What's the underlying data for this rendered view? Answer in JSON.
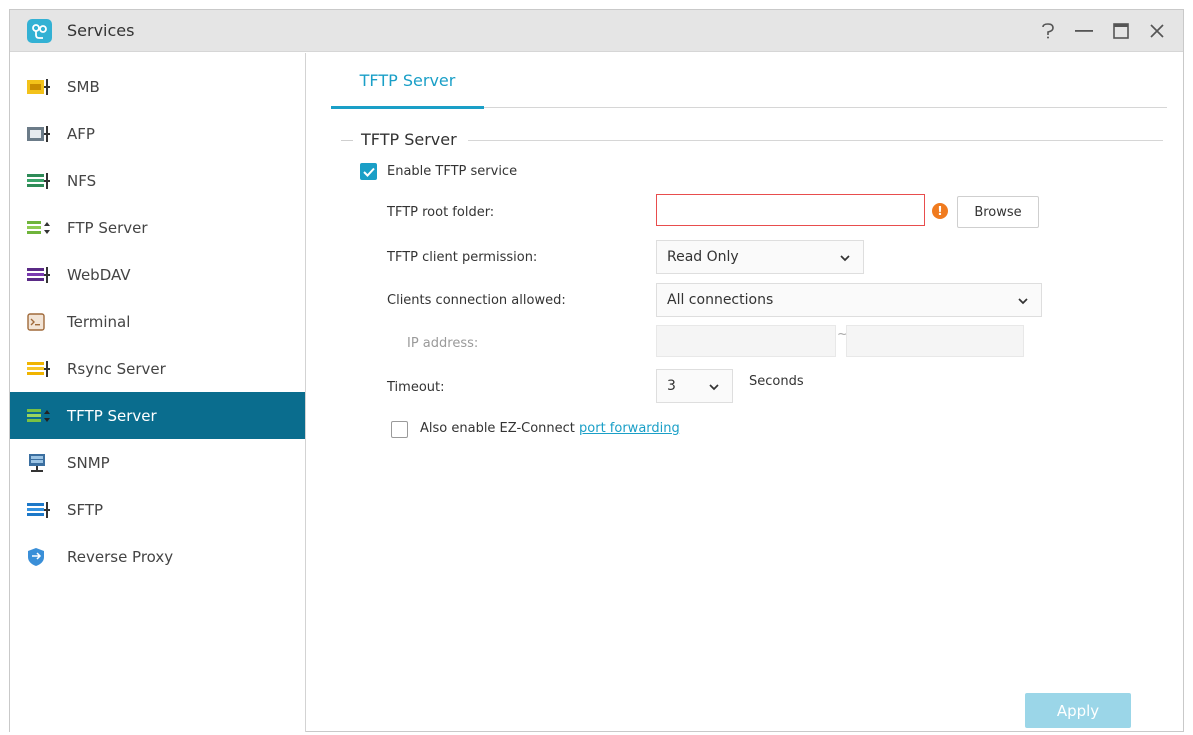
{
  "window": {
    "title": "Services",
    "controls": [
      "help-icon",
      "minimize-icon",
      "maximize-icon",
      "close-icon"
    ]
  },
  "sidebar": {
    "items": [
      {
        "label": "SMB",
        "icon": "smb-icon",
        "active": false
      },
      {
        "label": "AFP",
        "icon": "afp-icon",
        "active": false
      },
      {
        "label": "NFS",
        "icon": "nfs-icon",
        "active": false
      },
      {
        "label": "FTP Server",
        "icon": "ftp-server-icon",
        "active": false
      },
      {
        "label": "WebDAV",
        "icon": "webdav-icon",
        "active": false
      },
      {
        "label": "Terminal",
        "icon": "terminal-icon",
        "active": false
      },
      {
        "label": "Rsync Server",
        "icon": "rsync-server-icon",
        "active": false
      },
      {
        "label": "TFTP Server",
        "icon": "tftp-server-icon",
        "active": true
      },
      {
        "label": "SNMP",
        "icon": "snmp-icon",
        "active": false
      },
      {
        "label": "SFTP",
        "icon": "sftp-icon",
        "active": false
      },
      {
        "label": "Reverse Proxy",
        "icon": "reverse-proxy-icon",
        "active": false
      }
    ]
  },
  "tabs": [
    {
      "label": "TFTP Server",
      "active": true
    }
  ],
  "form": {
    "section_title": "TFTP Server",
    "enable_label": "Enable TFTP service",
    "enable_checked": true,
    "root_folder_label": "TFTP root folder:",
    "root_folder_value": "",
    "browse_label": "Browse",
    "permission_label": "TFTP client permission:",
    "permission_value": "Read Only",
    "connection_label": "Clients connection allowed:",
    "connection_value": "All connections",
    "ip_label": "IP address:",
    "ip_separator": "~",
    "timeout_label": "Timeout:",
    "timeout_value": "3",
    "timeout_unit": "Seconds",
    "ez_connect_prefix": "Also enable EZ-Connect",
    "ez_connect_link": "port forwarding",
    "ez_connect_checked": false,
    "apply_label": "Apply"
  },
  "colors": {
    "accent": "#1a9fc7",
    "sidebar_active": "#0a6d8e",
    "error_border": "#e84d4d",
    "warning": "#f07b1f",
    "apply_disabled": "#9bd6e8"
  }
}
